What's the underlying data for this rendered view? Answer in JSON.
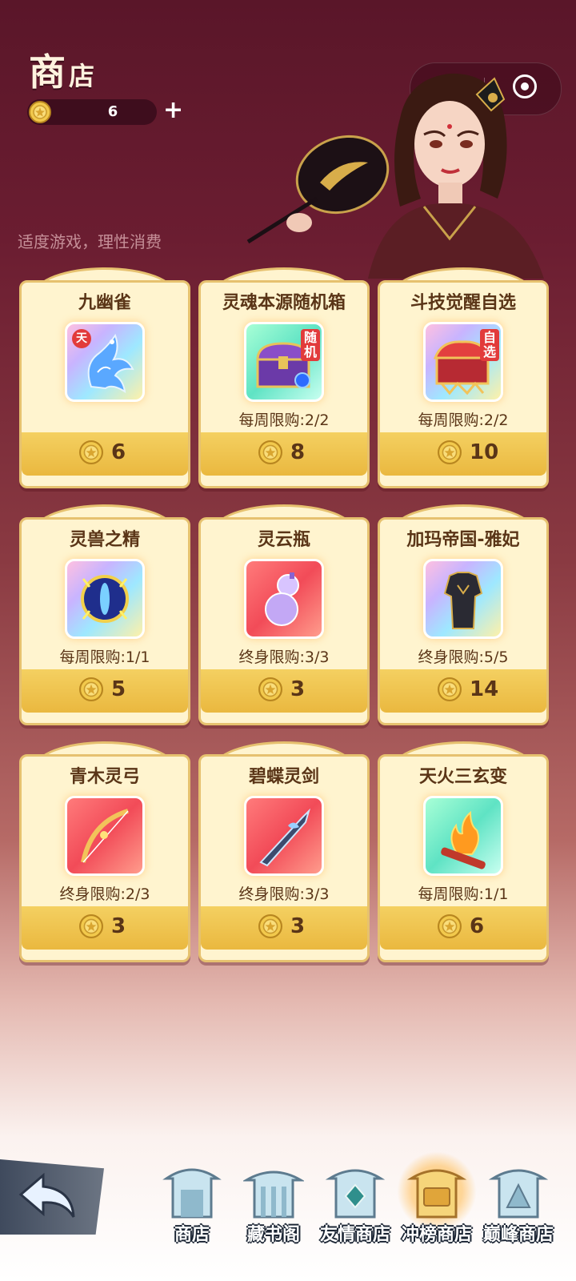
{
  "header": {
    "title_big": "商",
    "title_small": "店",
    "currency_count": "6",
    "add_symbol": "+",
    "menu_dots": "•••",
    "notice": "适度游戏，理性消费"
  },
  "items": [
    {
      "name": "九幽雀",
      "limit": "",
      "price": "6",
      "frame": "rainbow",
      "tag": "",
      "badge": "天",
      "icon": "ice-phoenix-icon"
    },
    {
      "name": "灵魂本源随机箱",
      "limit": "每周限购:2/2",
      "price": "8",
      "frame": "green",
      "tag": "随机",
      "badge": "",
      "icon": "treasure-chest-icon"
    },
    {
      "name": "斗技觉醒自选",
      "limit": "每周限购:2/2",
      "price": "10",
      "frame": "rainbow",
      "tag": "自选",
      "badge": "",
      "icon": "red-chest-icon"
    },
    {
      "name": "灵兽之精",
      "limit": "每周限购:1/1",
      "price": "5",
      "frame": "rainbow",
      "tag": "",
      "badge": "",
      "icon": "beast-orb-icon"
    },
    {
      "name": "灵云瓶",
      "limit": "终身限购:3/3",
      "price": "3",
      "frame": "red",
      "tag": "",
      "badge": "",
      "icon": "gourd-icon"
    },
    {
      "name": "加玛帝国-雅妃",
      "limit": "终身限购:5/5",
      "price": "14",
      "frame": "rainbow",
      "tag": "",
      "badge": "",
      "icon": "outfit-icon"
    },
    {
      "name": "青木灵弓",
      "limit": "终身限购:2/3",
      "price": "3",
      "frame": "red",
      "tag": "",
      "badge": "",
      "icon": "bow-icon"
    },
    {
      "name": "碧蝶灵剑",
      "limit": "终身限购:3/3",
      "price": "3",
      "frame": "red",
      "tag": "",
      "badge": "",
      "icon": "sword-icon"
    },
    {
      "name": "天火三玄变",
      "limit": "每周限购:1/1",
      "price": "6",
      "frame": "green",
      "tag": "",
      "badge": "",
      "icon": "fire-scroll-icon"
    }
  ],
  "nav": {
    "items": [
      {
        "label": "商店",
        "active": false
      },
      {
        "label": "藏书阁",
        "active": false
      },
      {
        "label": "友情商店",
        "active": false
      },
      {
        "label": "冲榜商店",
        "active": true
      },
      {
        "label": "巅峰商店",
        "active": false
      }
    ]
  },
  "colors": {
    "background_top": "#5a1629",
    "card_bg": "#fff4cf",
    "card_border": "#e6c16f",
    "price_bar": "#eab83f",
    "text_brown": "#5a3517"
  }
}
